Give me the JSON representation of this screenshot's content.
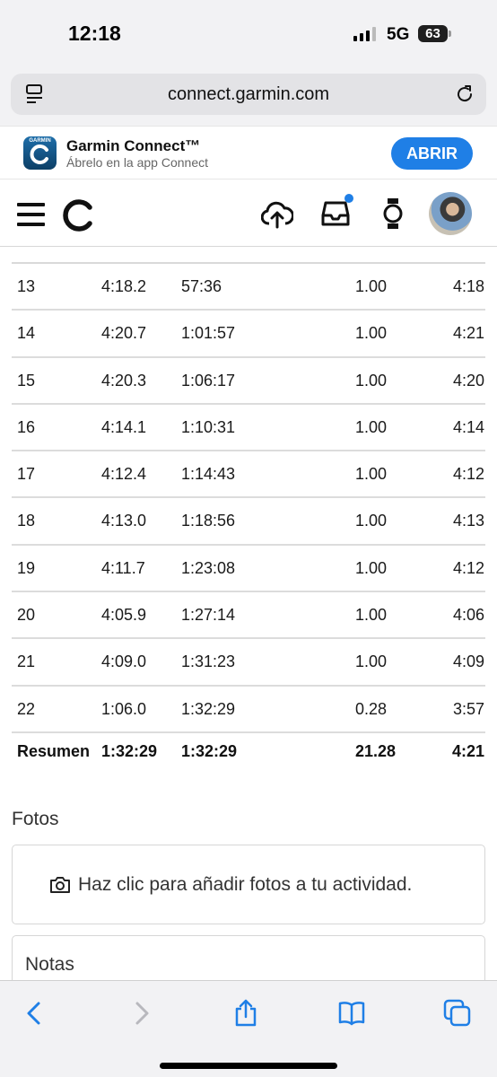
{
  "status_bar": {
    "time": "12:18",
    "network": "5G",
    "battery": "63"
  },
  "browser": {
    "url": "connect.garmin.com"
  },
  "app_banner": {
    "app_icon_label": "GARMIN",
    "app_name": "Garmin Connect™",
    "subtitle": "Ábrelo en la app Connect",
    "open_label": "ABRIR"
  },
  "nav": {
    "notification_dot": true,
    "icons": [
      "menu-icon",
      "garmin-logo-icon",
      "upload-icon",
      "inbox-icon",
      "watch-icon",
      "avatar"
    ]
  },
  "laps": {
    "rows": [
      {
        "lap": "13",
        "time": "4:18.2",
        "cumulative": "57:36",
        "distance": "1.00",
        "pace": "4:18"
      },
      {
        "lap": "14",
        "time": "4:20.7",
        "cumulative": "1:01:57",
        "distance": "1.00",
        "pace": "4:21"
      },
      {
        "lap": "15",
        "time": "4:20.3",
        "cumulative": "1:06:17",
        "distance": "1.00",
        "pace": "4:20"
      },
      {
        "lap": "16",
        "time": "4:14.1",
        "cumulative": "1:10:31",
        "distance": "1.00",
        "pace": "4:14"
      },
      {
        "lap": "17",
        "time": "4:12.4",
        "cumulative": "1:14:43",
        "distance": "1.00",
        "pace": "4:12"
      },
      {
        "lap": "18",
        "time": "4:13.0",
        "cumulative": "1:18:56",
        "distance": "1.00",
        "pace": "4:13"
      },
      {
        "lap": "19",
        "time": "4:11.7",
        "cumulative": "1:23:08",
        "distance": "1.00",
        "pace": "4:12"
      },
      {
        "lap": "20",
        "time": "4:05.9",
        "cumulative": "1:27:14",
        "distance": "1.00",
        "pace": "4:06"
      },
      {
        "lap": "21",
        "time": "4:09.0",
        "cumulative": "1:31:23",
        "distance": "1.00",
        "pace": "4:09"
      },
      {
        "lap": "22",
        "time": "1:06.0",
        "cumulative": "1:32:29",
        "distance": "0.28",
        "pace": "3:57"
      }
    ],
    "summary": {
      "label": "Resumen",
      "time": "1:32:29",
      "cumulative": "1:32:29",
      "distance": "21.28",
      "pace": "4:21"
    }
  },
  "photos": {
    "title": "Fotos",
    "add_text": "Haz clic para añadir fotos a tu actividad."
  },
  "notes": {
    "title": "Notas"
  },
  "toolbar": {
    "icons": [
      "back-icon",
      "forward-icon",
      "share-icon",
      "bookmarks-icon",
      "tabs-icon"
    ]
  },
  "colors": {
    "accent": "#1f7fe6",
    "divider": "#dcdcdc",
    "chrome_bg": "#f2f2f4"
  }
}
